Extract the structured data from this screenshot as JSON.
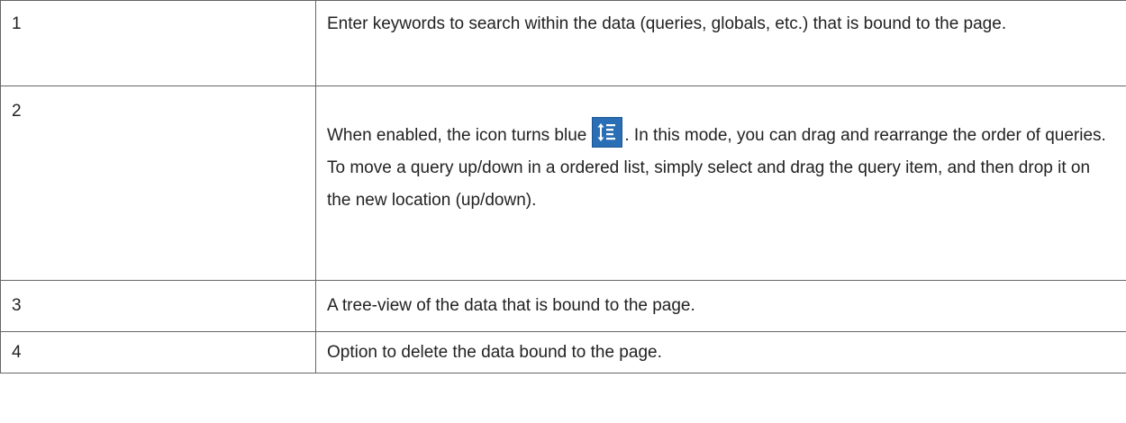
{
  "rows": [
    {
      "number": "1",
      "description": "Enter keywords to search within the data (queries, globals, etc.) that is bound to the page."
    },
    {
      "number": "2",
      "description_before_icon": "When enabled, the icon turns blue",
      "icon": "reorder-icon",
      "icon_color": "#2a6fb5",
      "description_after_icon": ". In this mode, you can drag and rearrange the order of queries. To move a query up/down in a ordered list, simply select and drag the query item, and then drop it on the new location (up/down)."
    },
    {
      "number": "3",
      "description": "A tree-view of the data that is bound to the page."
    },
    {
      "number": "4",
      "description": "Option to delete the data bound to the page."
    }
  ]
}
